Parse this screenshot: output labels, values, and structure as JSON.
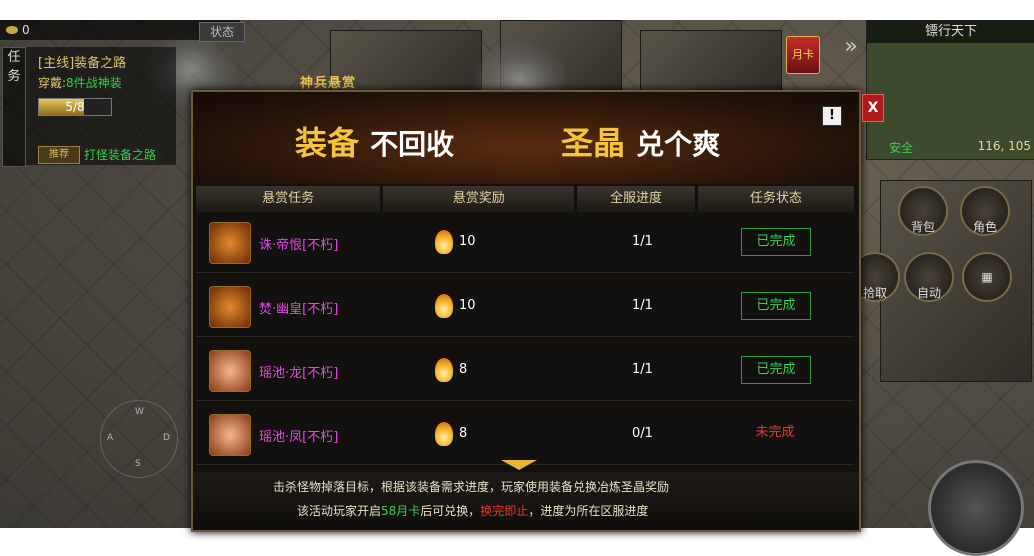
{
  "hud": {
    "gold": "0",
    "status_btn": "状态",
    "task_tab": [
      "任",
      "务"
    ],
    "quest_title": "[主线]装备之路",
    "quest_wear_prefix": "穿戴:",
    "quest_wear_item": "8件战神装",
    "quest_progress_text": "5/8",
    "quest_progress": 0.625,
    "quest_hint_tag": "推荐",
    "quest_hint": "打怪装备之路"
  },
  "minimap": {
    "title": "镖行天下",
    "safe": "安全",
    "coords": "116, 105"
  },
  "month_card": "月卡",
  "side_buttons": {
    "bag": "背包",
    "role": "角色",
    "pickup": "拾取",
    "auto": "自动"
  },
  "joystick": {
    "w": "W",
    "a": "A",
    "s": "S",
    "d": "D"
  },
  "modal": {
    "tab_name": "神兵悬赏",
    "banner_left_gold": "装备",
    "banner_left_white": "不回收",
    "banner_right_gold": "圣晶",
    "banner_right_white": "兑个爽",
    "info": "!",
    "close": "X",
    "columns": [
      "悬赏任务",
      "悬赏奖励",
      "全服进度",
      "任务状态"
    ],
    "rows": [
      {
        "name": "诛·帝恨[不朽]",
        "reward": "10",
        "progress": "1/1",
        "status": "已完成"
      },
      {
        "name": "焚·幽皇[不朽]",
        "reward": "10",
        "progress": "1/1",
        "status": "已完成"
      },
      {
        "name": "瑶池·龙[不朽]",
        "reward": "8",
        "progress": "1/1",
        "status": "已完成"
      },
      {
        "name": "瑶池·凤[不朽]",
        "reward": "8",
        "progress": "0/1",
        "status": "未完成"
      }
    ],
    "footer_line1": "击杀怪物掉落目标，根据该装备需求进度，玩家使用装备兑换冶炼圣晶奖励",
    "footer_line2_a": "该活动玩家开启",
    "footer_line2_b": "58月卡",
    "footer_line2_c": "后可兑换，",
    "footer_line2_d": "换完即止",
    "footer_line2_e": "，进度为所在区服进度"
  },
  "colors": {
    "gold": "#f4c43c",
    "green_done": "#35d04a",
    "red_incomplete": "#e23a2a",
    "item_name": "#e04ae0"
  }
}
